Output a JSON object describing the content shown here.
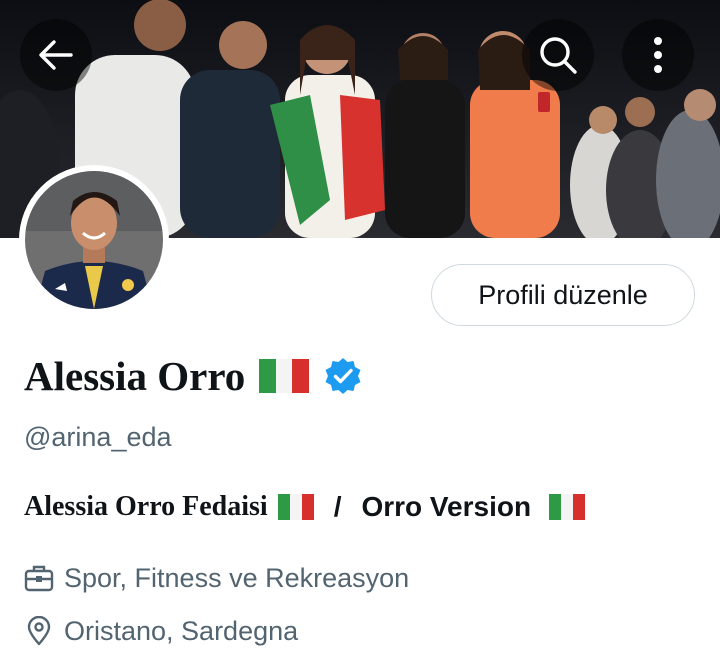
{
  "header": {
    "back_icon": "arrow-left-icon",
    "search_icon": "search-icon",
    "more_icon": "more-vertical-icon"
  },
  "profile": {
    "edit_button_label": "Profili düzenle",
    "name": "Alessia Orro",
    "verified_icon": "verified-badge-icon",
    "handle": "@arina_eda",
    "bio_part1": "Alessia Orro Fedaisi",
    "bio_separator": "/",
    "bio_part2": "Orro Version",
    "category": "Spor, Fitness ve Rekreasyon",
    "location": "Oristano, Sardegna"
  },
  "colors": {
    "accent_blue": "#1d9bf0",
    "secondary_text": "#536471",
    "primary_text": "#0f1419",
    "border": "#cfd9de"
  }
}
